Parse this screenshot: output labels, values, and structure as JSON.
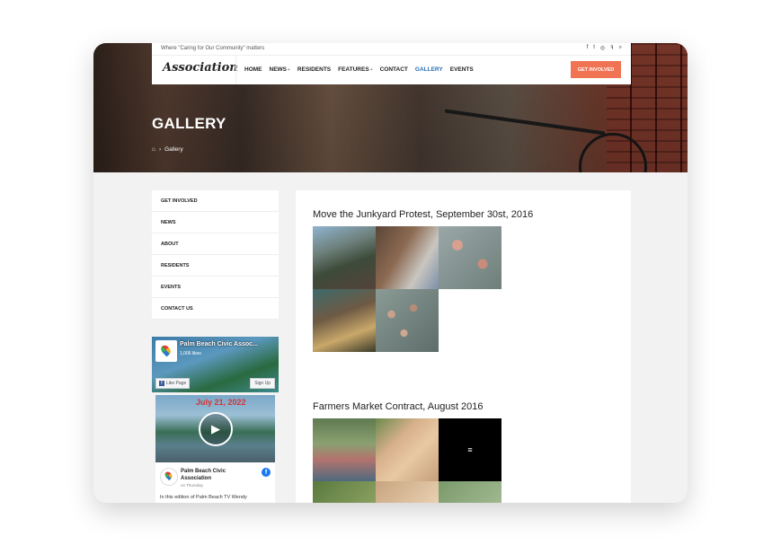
{
  "header": {
    "tagline": "Where \"Caring for Our Community\" matters",
    "logo": "Association",
    "social_icons": [
      "facebook-icon",
      "twitter-icon",
      "instagram-icon",
      "foursquare-icon",
      "search-icon"
    ],
    "social_glyphs": [
      "f",
      "t",
      "◎",
      "ꟻ",
      "⌕"
    ],
    "nav": {
      "home": "HOME",
      "news": "NEWS",
      "residents": "RESIDENTS",
      "features": "FEATURES",
      "contact": "CONTACT",
      "gallery": "GALLERY",
      "events": "EVENTS",
      "caret": "+"
    },
    "cta": "GET INVOLVED"
  },
  "hero": {
    "title": "GALLERY",
    "breadcrumb_home_icon": "⌂",
    "breadcrumb_sep": "›",
    "breadcrumb_current": "Gallery"
  },
  "sidebar": {
    "items": [
      "GET INVOLVED",
      "NEWS",
      "ABOUT",
      "RESIDENTS",
      "EVENTS",
      "CONTACT US"
    ]
  },
  "facebook": {
    "page_name": "Palm Beach Civic Assoc...",
    "likes": "1,006 likes",
    "like_button": "Like Page",
    "signup_button": "Sign Up",
    "video_date": "July 21, 2022",
    "post_name": "Palm Beach Civic Association",
    "post_time": "on Thursday",
    "post_text": "In this edition of Palm Beach TV Wendy"
  },
  "gallery": {
    "album1_title": "Move the Junkyard Protest, September 30st, 2016",
    "album2_title": "Farmers Market Contract, August 2016",
    "menu_glyph": "≡"
  },
  "colors": {
    "accent": "#f07454",
    "active_nav": "#2a6fb5"
  }
}
